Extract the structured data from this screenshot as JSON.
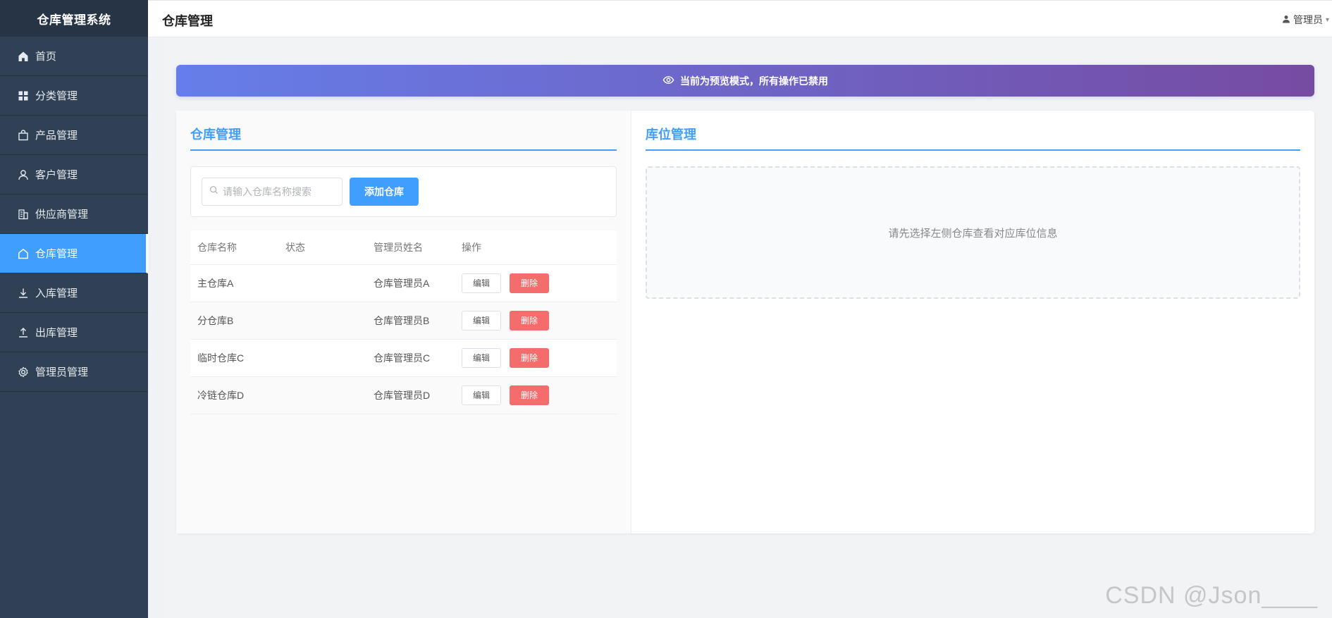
{
  "app": {
    "title": "仓库管理系统"
  },
  "sidebar": {
    "items": [
      {
        "label": "首页",
        "icon": "home-icon"
      },
      {
        "label": "分类管理",
        "icon": "grid-icon"
      },
      {
        "label": "产品管理",
        "icon": "shopping-bag-icon"
      },
      {
        "label": "客户管理",
        "icon": "user-icon"
      },
      {
        "label": "供应商管理",
        "icon": "office-building-icon"
      },
      {
        "label": "仓库管理",
        "icon": "warehouse-icon",
        "active": true
      },
      {
        "label": "入库管理",
        "icon": "download-icon"
      },
      {
        "label": "出库管理",
        "icon": "upload-icon"
      },
      {
        "label": "管理员管理",
        "icon": "gear-icon"
      }
    ]
  },
  "header": {
    "page_title": "仓库管理",
    "user_label": "管理员"
  },
  "banner": {
    "text": "当前为预览模式，所有操作已禁用",
    "icon": "eye-icon"
  },
  "colors": {
    "accent": "#409eff",
    "danger": "#f56c6c",
    "sidebar_bg": "#304156",
    "banner_start": "#667eea",
    "banner_end": "#764ba2"
  },
  "warehouse_panel": {
    "title": "仓库管理",
    "search_placeholder": "请输入仓库名称搜索",
    "add_button": "添加仓库",
    "columns": [
      "仓库名称",
      "状态",
      "管理员姓名",
      "操作"
    ],
    "edit_label": "编辑",
    "delete_label": "删除",
    "rows": [
      {
        "name": "主仓库A",
        "status": "",
        "manager": "仓库管理员A"
      },
      {
        "name": "分仓库B",
        "status": "",
        "manager": "仓库管理员B"
      },
      {
        "name": "临时仓库C",
        "status": "",
        "manager": "仓库管理员C"
      },
      {
        "name": "冷链仓库D",
        "status": "",
        "manager": "仓库管理员D"
      }
    ]
  },
  "location_panel": {
    "title": "库位管理",
    "empty_text": "请先选择左侧仓库查看对应库位信息"
  },
  "watermark": "CSDN @Json____"
}
